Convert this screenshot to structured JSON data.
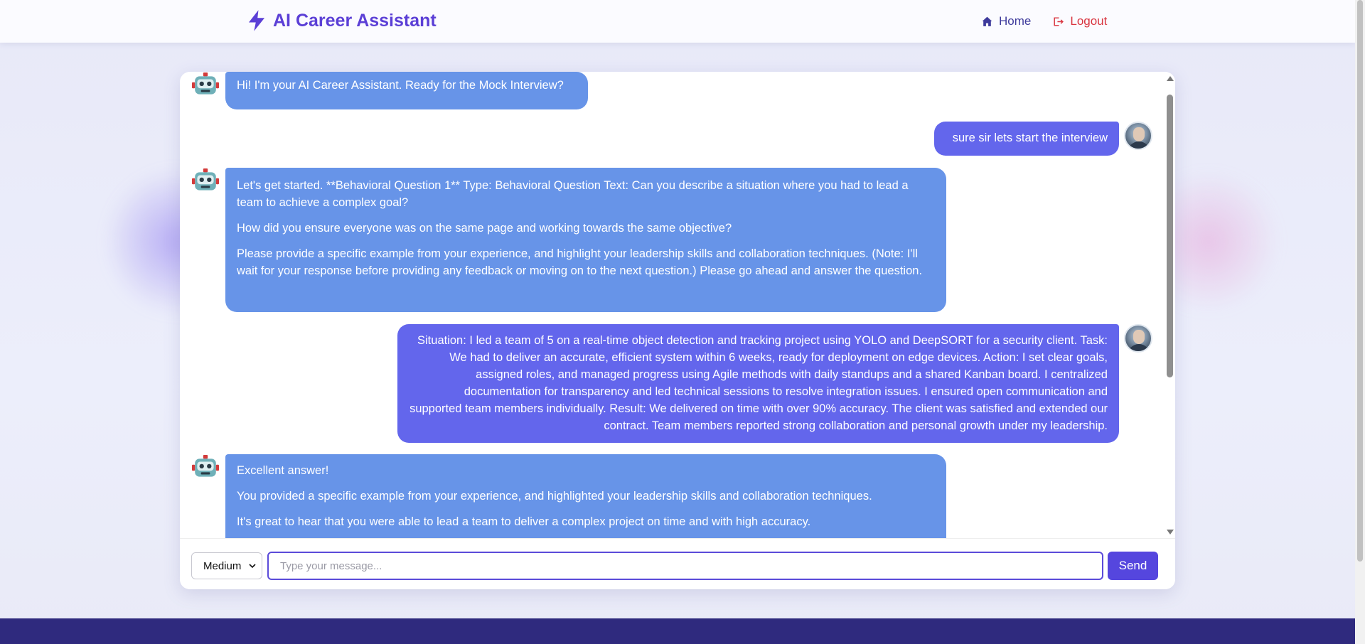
{
  "header": {
    "brand_title": "AI Career Assistant",
    "brand_icon": "lightning-bolt-icon",
    "nav": [
      {
        "label": "Home",
        "icon": "home-icon"
      },
      {
        "label": "Logout",
        "icon": "logout-icon"
      }
    ]
  },
  "colors": {
    "brand": "#5b3fd6",
    "bot_bubble": "#6794e8",
    "user_bubble": "#6366ec",
    "send_button": "#5546de",
    "footer": "#2f2a7e",
    "logout": "#d9343f"
  },
  "chat": {
    "messages": [
      {
        "sender": "bot",
        "paragraphs": [
          "Hi! I'm your AI Career Assistant. Ready for the Mock Interview?"
        ]
      },
      {
        "sender": "user",
        "paragraphs": [
          "sure sir lets start the interview"
        ]
      },
      {
        "sender": "bot",
        "paragraphs": [
          "Let's get started. **Behavioral Question 1** Type: Behavioral Question Text: Can you describe a situation where you had to lead a team to achieve a complex goal?",
          "How did you ensure everyone was on the same page and working towards the same objective?",
          "Please provide a specific example from your experience, and highlight your leadership skills and collaboration techniques. (Note: I'll wait for your response before providing any feedback or moving on to the next question.) Please go ahead and answer the question."
        ]
      },
      {
        "sender": "user",
        "paragraphs": [
          "Situation: I led a team of 5 on a real-time object detection and tracking project using YOLO and DeepSORT for a security client. Task: We had to deliver an accurate, efficient system within 6 weeks, ready for deployment on edge devices. Action: I set clear goals, assigned roles, and managed progress using Agile methods with daily standups and a shared Kanban board. I centralized documentation for transparency and led technical sessions to resolve integration issues. I ensured open communication and supported team members individually. Result: We delivered on time with over 90% accuracy. The client was satisfied and extended our contract. Team members reported strong collaboration and personal growth under my leadership."
        ]
      },
      {
        "sender": "bot",
        "paragraphs": [
          "Excellent answer!",
          "You provided a specific example from your experience, and highlighted your leadership skills and collaboration techniques.",
          "It's great to hear that you were able to lead a team to deliver a complex project on time and with high accuracy."
        ]
      }
    ]
  },
  "input": {
    "difficulty_selected": "Medium",
    "message_placeholder": "Type your message...",
    "message_value": "",
    "send_label": "Send"
  }
}
